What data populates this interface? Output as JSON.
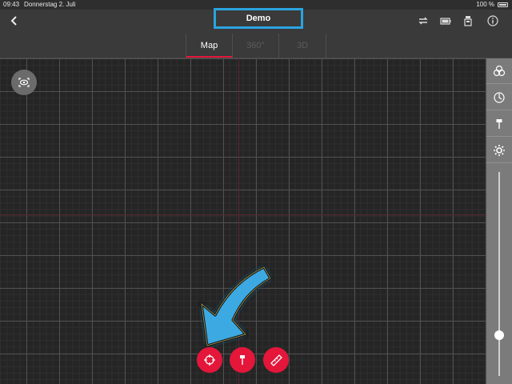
{
  "status_bar": {
    "time": "09:43",
    "date": "Donnerstag 2. Juli",
    "battery": "100 %"
  },
  "header": {
    "title": "Demo",
    "icons": [
      "back-icon",
      "sync-icon",
      "battery-icon",
      "device-icon",
      "info-icon"
    ]
  },
  "tabs": [
    {
      "label": "Map",
      "active": true
    },
    {
      "label": "360°",
      "active": false
    },
    {
      "label": "3D",
      "active": false
    }
  ],
  "sidebar": {
    "icons": [
      "layers-icon",
      "compass-icon",
      "pin-icon",
      "settings-icon"
    ],
    "zoom_slider_level": 0.2
  },
  "fabs": [
    "target-icon",
    "pin-icon",
    "measure-icon"
  ],
  "colors": {
    "accent": "#e4163a",
    "highlight": "#2aa3e0",
    "background": "#252525"
  }
}
